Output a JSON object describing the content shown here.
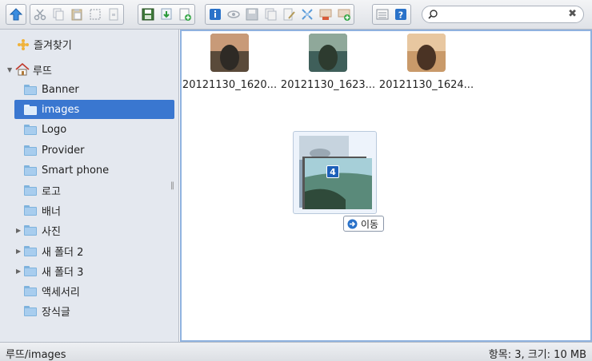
{
  "toolbar": {
    "groups": [
      [
        "go-up-icon"
      ],
      [
        "cut-icon",
        "copy-icon",
        "paste-icon",
        "select-all-icon",
        "archive-icon"
      ],
      [
        "save-icon",
        "download-icon",
        "new-file-icon"
      ],
      [
        "info-icon",
        "view-icon",
        "save-as-icon",
        "duplicate-icon",
        "rename-icon",
        "resize-icon",
        "extract-icon",
        "compress-icon"
      ],
      [
        "list-view-icon",
        "help-icon"
      ]
    ]
  },
  "search": {
    "value": "",
    "placeholder": ""
  },
  "sidebar": {
    "favorites_label": "즐겨찾기",
    "root_label": "루뜨",
    "items": [
      {
        "label": "Banner",
        "expandable": false,
        "selected": false
      },
      {
        "label": "images",
        "expandable": false,
        "selected": true
      },
      {
        "label": "Logo",
        "expandable": false,
        "selected": false
      },
      {
        "label": "Provider",
        "expandable": false,
        "selected": false
      },
      {
        "label": "Smart phone",
        "expandable": false,
        "selected": false
      },
      {
        "label": "로고",
        "expandable": false,
        "selected": false
      },
      {
        "label": "배너",
        "expandable": false,
        "selected": false
      },
      {
        "label": "사진",
        "expandable": true,
        "selected": false
      },
      {
        "label": "새 폴더 2",
        "expandable": true,
        "selected": false
      },
      {
        "label": "새 폴더 3",
        "expandable": true,
        "selected": false
      },
      {
        "label": "액세서리",
        "expandable": false,
        "selected": false
      },
      {
        "label": "장식글",
        "expandable": false,
        "selected": false
      }
    ]
  },
  "files": [
    {
      "name": "20121130_1620...",
      "colors": [
        "#5a4a3a",
        "#c89a78",
        "#2e2a25"
      ]
    },
    {
      "name": "20121130_1623...",
      "colors": [
        "#3f5f5a",
        "#8fa89a",
        "#2d3b2f"
      ]
    },
    {
      "name": "20121130_1624...",
      "colors": [
        "#c99a6a",
        "#e8c7a0",
        "#4a3324"
      ]
    }
  ],
  "drag": {
    "count": "4",
    "move_label": "이동"
  },
  "status": {
    "path": "루뜨/images",
    "summary": "항목: 3, 크기: 10 MB"
  },
  "colors": {
    "selection": "#3a77d0",
    "accent_border": "#8fb2df"
  }
}
